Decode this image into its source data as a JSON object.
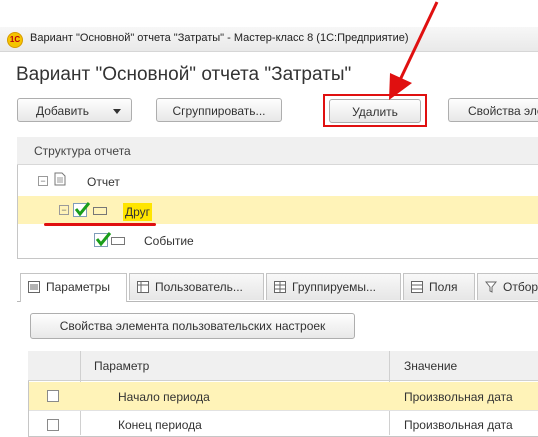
{
  "window": {
    "app_title": "Вариант \"Основной\" отчета \"Затраты\" - Мастер-класс 8  (1С:Предприятие)",
    "heading": "Вариант \"Основной\" отчета \"Затраты\"",
    "logo_text": "1С"
  },
  "toolbar": {
    "add_label": "Добавить",
    "group_label": "Сгруппировать...",
    "delete_label": "Удалить",
    "properties_label": "Свойства эле"
  },
  "structure": {
    "header": "Структура отчета",
    "nodes": [
      {
        "label": "Отчет",
        "level": 0
      },
      {
        "label": "Друг",
        "level": 1,
        "selected": true
      },
      {
        "label": "Событие",
        "level": 2
      }
    ]
  },
  "tabs": [
    {
      "label": "Параметры",
      "icon": "parameters-icon",
      "active": true
    },
    {
      "label": "Пользователь...",
      "icon": "user-fields-icon"
    },
    {
      "label": "Группируемы...",
      "icon": "grouping-icon"
    },
    {
      "label": "Поля",
      "icon": "fields-icon"
    },
    {
      "label": "Отбор",
      "icon": "filter-icon"
    }
  ],
  "settings": {
    "element_properties_label": "Свойства элемента пользовательских настроек"
  },
  "grid": {
    "columns": [
      "Параметр",
      "Значение"
    ],
    "rows": [
      {
        "parameter": "Начало периода",
        "value": "Произвольная дата",
        "checked": false,
        "selected": true
      },
      {
        "parameter": "Конец периода",
        "value": "Произвольная дата",
        "checked": false,
        "selected": false
      }
    ]
  },
  "colors": {
    "accent_red": "#e01010",
    "selection_bg": "#fff3b8",
    "highlight_yellow": "#ffe500",
    "check_green": "#1a9e1a"
  }
}
